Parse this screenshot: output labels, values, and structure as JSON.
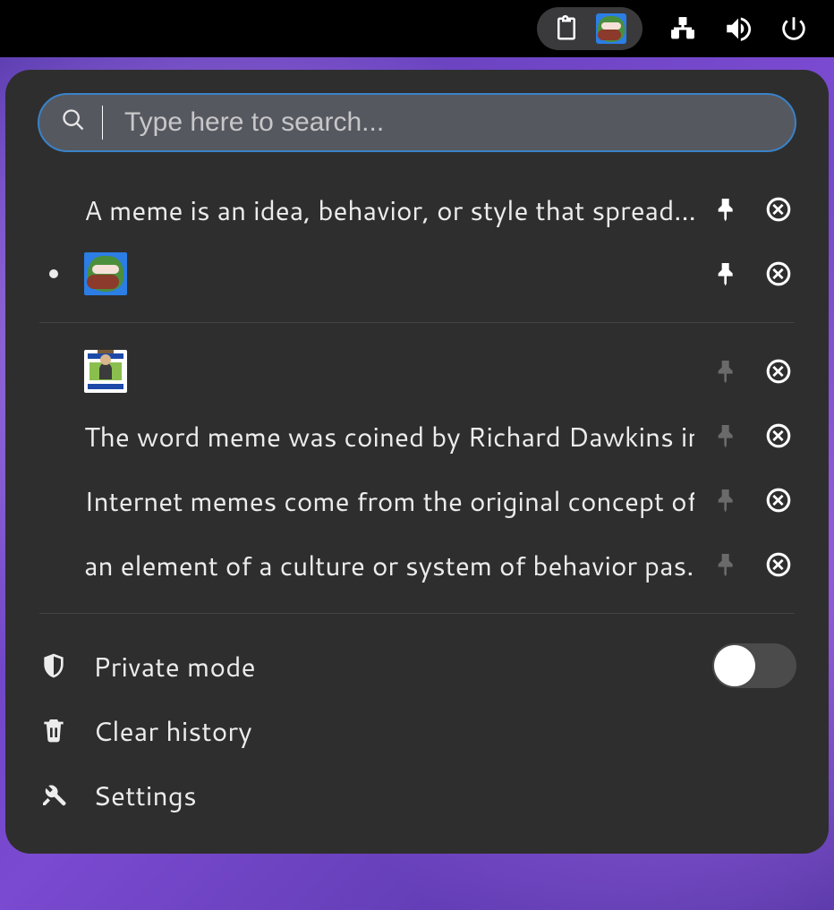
{
  "search": {
    "placeholder": "Type here to search...",
    "value": ""
  },
  "clips": {
    "pinned": [
      {
        "type": "text",
        "text": "A meme is an idea, behavior, or style that spread..."
      },
      {
        "type": "image",
        "image": "pepe",
        "selected": true
      }
    ],
    "unpinned": [
      {
        "type": "image",
        "image": "whatif"
      },
      {
        "type": "text",
        "text": "The word meme was coined by Richard Dawkins in hi..."
      },
      {
        "type": "text",
        "text": "Internet memes come from the original concept of ..."
      },
      {
        "type": "text",
        "text": "an element of a culture or system of behavior pas..."
      }
    ]
  },
  "footer": {
    "private_mode": "Private mode",
    "private_mode_on": false,
    "clear_history": "Clear history",
    "settings": "Settings"
  }
}
